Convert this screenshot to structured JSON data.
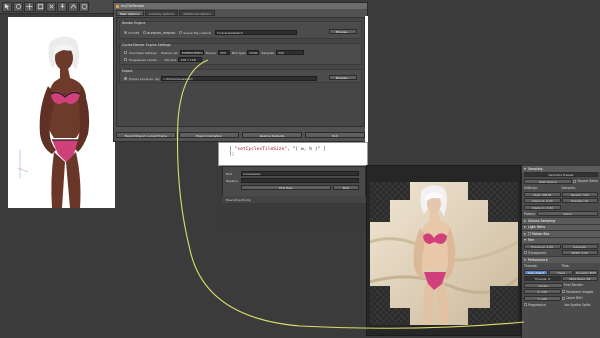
{
  "viewport": {
    "toolbar_icons": [
      "select-icon",
      "rotate-icon",
      "move-icon",
      "scale-icon",
      "universal-icon",
      "pose-icon",
      "node-icon",
      "help-icon"
    ]
  },
  "dialog": {
    "title": "mcjTileRender",
    "tabs": [
      "Main Options",
      "Auxiliary Options",
      "Additional Options"
    ],
    "render_engine": {
      "title": "Render Engine",
      "options": [
        "CYCLES",
        "BLENDER_RENDER",
        "Scene File (.blend)"
      ],
      "selected": "CYCLES",
      "scene_path": "D:/scenes/sketch",
      "browse_label": "Browse..."
    },
    "cycles": {
      "title": "Cycles Render Engine Settings",
      "use_these_settings_label": "Use these settings",
      "feature_set_label": "Feature set",
      "feature_set_value": "EXPERIMENTAL",
      "device_label": "Device",
      "device_value": "CPU",
      "bvh_label": "Bvh type",
      "bvh_value": "DYNA",
      "samples_label": "Samples",
      "samples_value": "500",
      "progressive_label": "Progressive render",
      "tile_size_label": "Tile Size",
      "tile_size_value": "128 x 128"
    },
    "export": {
      "title": "Export",
      "export_label": "Export scene as .obj",
      "path": "c:/tmp/sceneexport",
      "browse_label": "Browse..."
    },
    "footer_buttons": [
      "Export/Import current frame",
      "Export Animation",
      "Restore Defaults",
      "Exit"
    ]
  },
  "script": {
    "line1_prefix": "[ ",
    "line1_string": "\"setCyclesTileSize\"",
    "line1_suffix": ", \"( w, h )\" ]",
    "line2": "];"
  },
  "find": {
    "find_label": "Find",
    "find_value": "progressive",
    "replace_label": "Replace",
    "find_next_label": "Find Prev",
    "find_prev_label": "Find"
  },
  "exec_label": "Executing Dump",
  "props": {
    "sampling_header": "Sampling",
    "preset_value": "Sampling Presets",
    "path_tracing": "Path Tracing",
    "square_samples": "Square Samp",
    "settings_label": "Settings:",
    "samples_label": "Samples:",
    "seed": "Seed:",
    "seed_value": "58194",
    "render_s": "Render:",
    "render_value": "500",
    "clamp_direct": "Clamp D: 0.00",
    "preview": "Preview:",
    "preview_value": "10",
    "clamp_indirect": "Clamp In: 0.00",
    "pattern_label": "Pattern:",
    "pattern_value": "Sobol",
    "volume_sampling": "Volume Sampling",
    "light_paths": "Light Paths",
    "motion_blur": "Motion Blur",
    "film": "Film",
    "exposure": "Exposure: 1.00",
    "gaussian": "Gaussian",
    "transparent": "Transparent",
    "width": "Width: 1.50",
    "performance": "Performance",
    "threads": "Threads:",
    "tiles": "Tiles:",
    "auto_detect": "Auto-detect",
    "fixed": "Fixed",
    "dynamic_bvh": "Dynamic BVH",
    "thread_count": "Threads: 8",
    "start_resol": "Start Resol: 64",
    "center": "Center",
    "final_render": "Final Render:",
    "x_value": "X: 128",
    "y_value": "Y: 128",
    "persistent_images": "Persistent Images",
    "progressive": "Progressive",
    "cache_bvh": "Cache BVH",
    "use_spatial_splits": "Use Spatial Splits"
  },
  "colors": {
    "connector": "#dede6a",
    "accent": "#5680c2",
    "bikini": "#d0407a"
  }
}
